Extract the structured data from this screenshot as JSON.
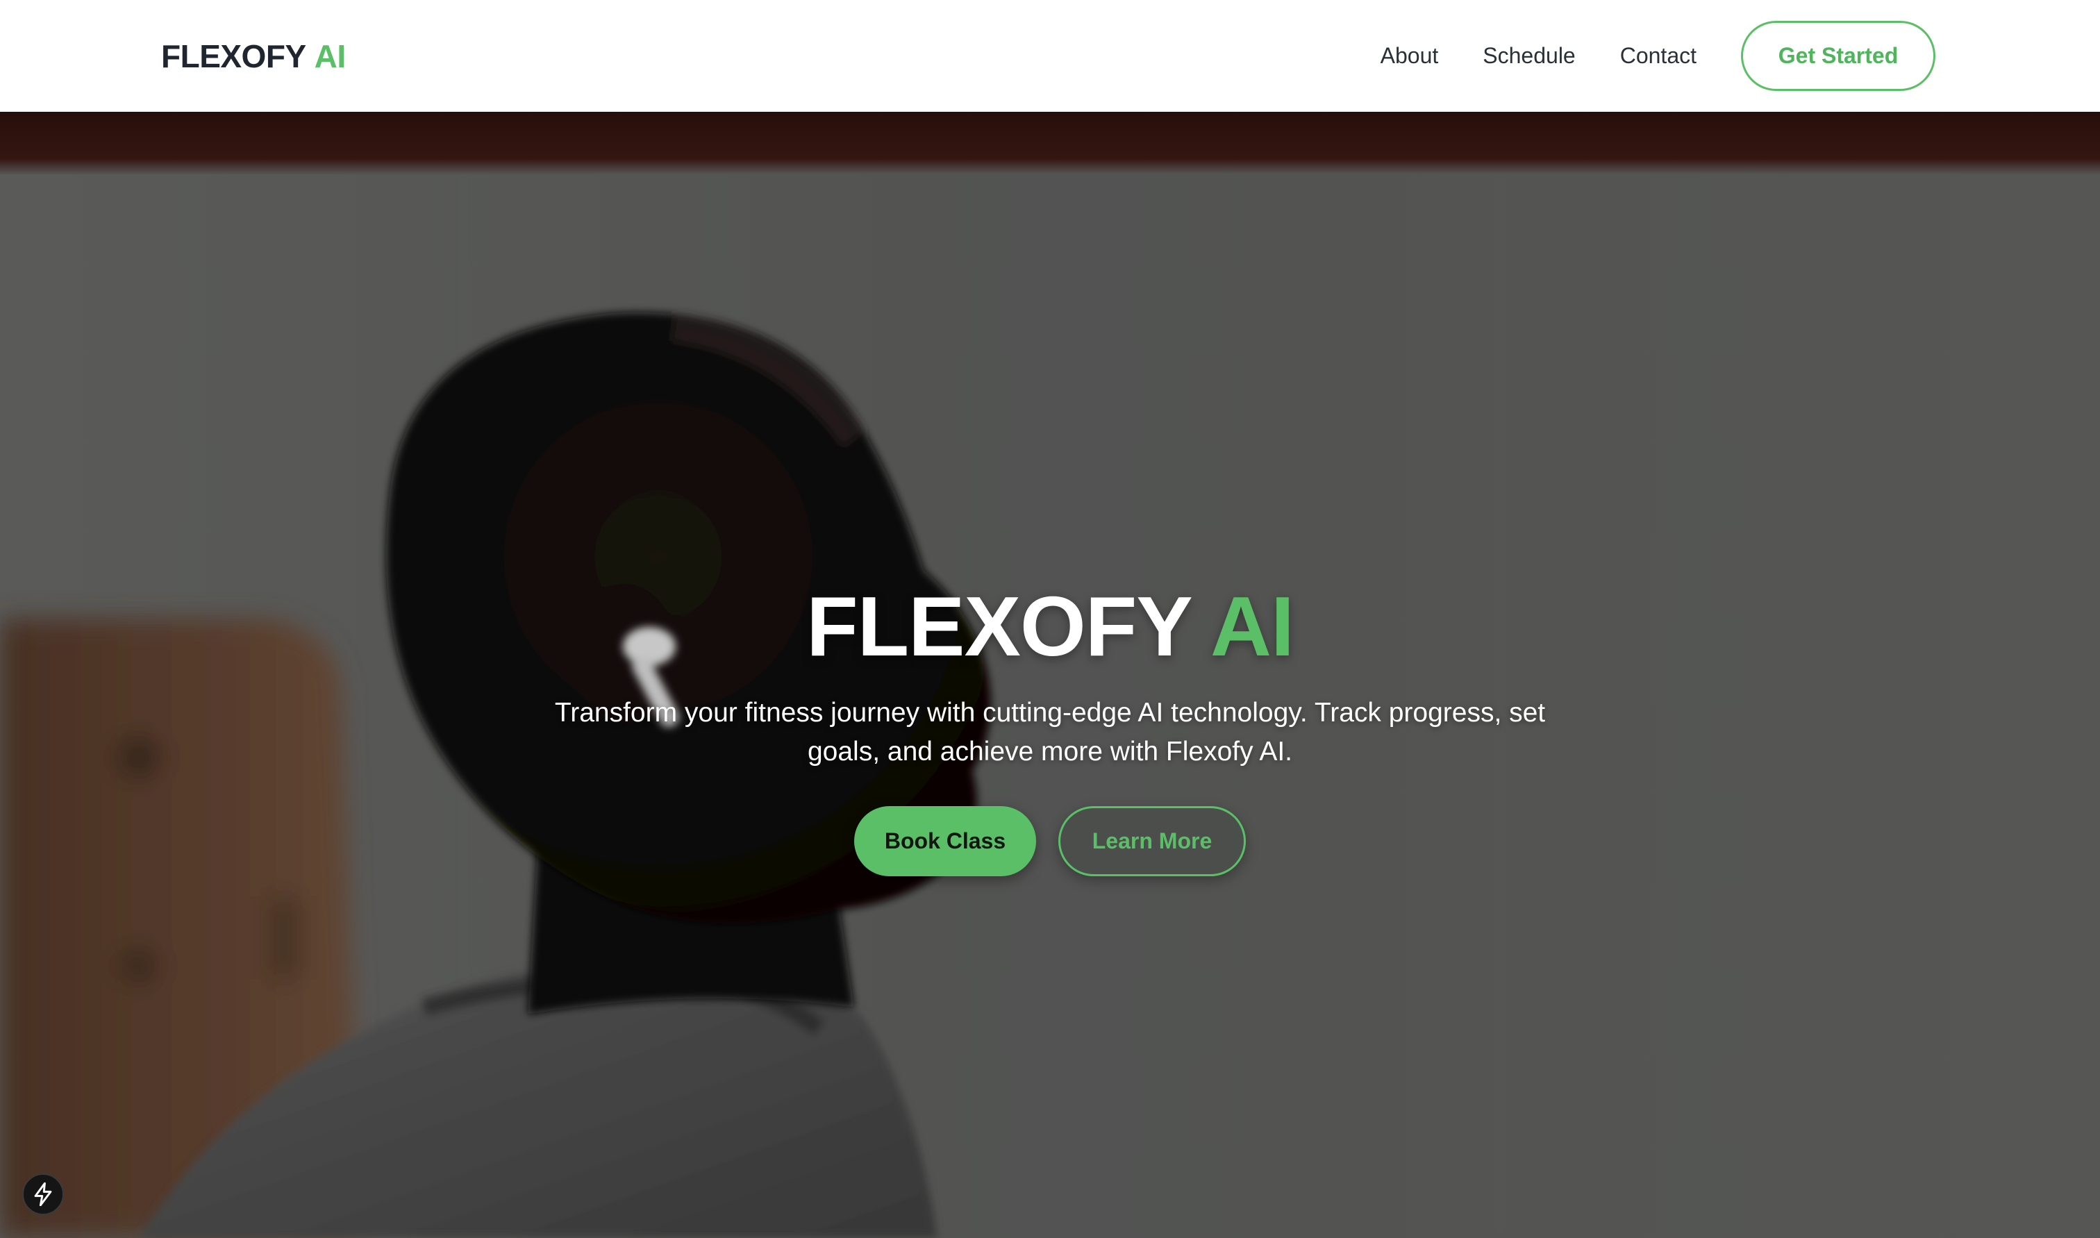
{
  "header": {
    "logo_main": "FLEXOFY",
    "logo_accent": "AI",
    "nav": {
      "about": "About",
      "schedule": "Schedule",
      "contact": "Contact"
    },
    "cta_label": "Get Started"
  },
  "hero": {
    "title_main": "FLEXOFY",
    "title_accent": "AI",
    "subtitle": "Transform your fitness journey with cutting-edge AI technology. Track progress, set goals, and achieve more with Flexofy AI.",
    "primary_button": "Book Class",
    "secondary_button": "Learn More"
  },
  "icons": {
    "corner_badge": "lightning-bolt-icon"
  },
  "colors": {
    "accent": "#5bbf67",
    "text_dark": "#1f2630",
    "hero_overlay": "#5e5e5c"
  }
}
